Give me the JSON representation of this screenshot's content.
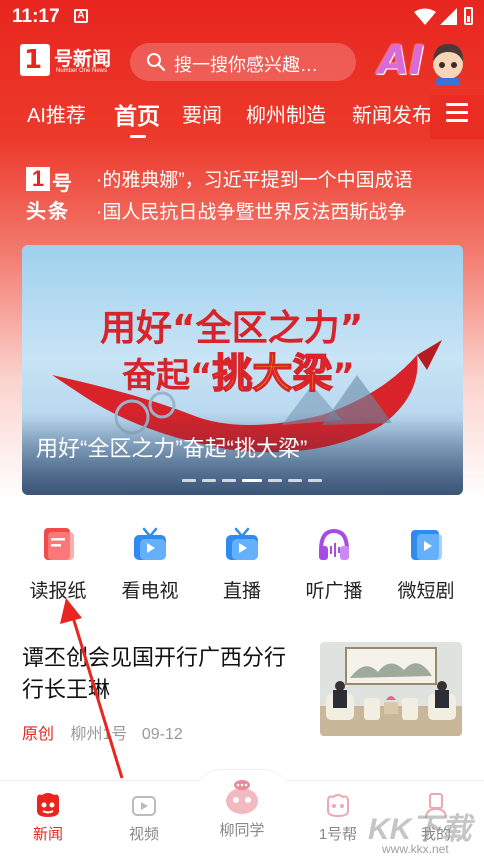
{
  "status_bar": {
    "time": "11:17",
    "notification_letter": "A"
  },
  "header": {
    "logo_num": "1",
    "logo_name": "号新闻",
    "logo_subtitle": "Number One News",
    "search_placeholder": "搜一搜你感兴趣…",
    "ai_label": "AI"
  },
  "tabs": [
    {
      "label": "AI推荐",
      "active": false
    },
    {
      "label": "首页",
      "active": true
    },
    {
      "label": "要闻",
      "active": false
    },
    {
      "label": "柳州制造",
      "active": false
    },
    {
      "label": "新闻发布",
      "active": false
    }
  ],
  "headline": {
    "logo_num": "1",
    "logo_hao": "号",
    "logo_toutiao": "头条",
    "items": [
      "·的雅典娜”，习近平提到一个中国成语",
      "·国人民抗日战争暨世界反法西斯战争"
    ]
  },
  "banner": {
    "title_part1": "用好“全区之力”",
    "title_part2_prefix": "奋起“",
    "title_part2_highlight": "挑大梁",
    "title_part2_suffix": "”",
    "caption": "用好“全区之力”奋起“挑大梁”",
    "slide_count": 7,
    "active_slide": 4
  },
  "quick_nav": [
    {
      "label": "读报纸",
      "icon": "newspaper-icon",
      "color": "#f04a4a"
    },
    {
      "label": "看电视",
      "icon": "tv-icon",
      "color": "#2f8bf0"
    },
    {
      "label": "直播",
      "icon": "live-tv-icon",
      "color": "#2f8bf0"
    },
    {
      "label": "听广播",
      "icon": "headphones-icon",
      "color": "#a74be6"
    },
    {
      "label": "微短剧",
      "icon": "short-drama-icon",
      "color": "#2f8bf0"
    }
  ],
  "news": [
    {
      "title": "谭丕创会见国开行广西分行行长王琳",
      "tag": "原创",
      "source": "柳州1号",
      "date": "09-12"
    }
  ],
  "bottom_nav": [
    {
      "label": "新闻",
      "icon": "news-icon",
      "active": true
    },
    {
      "label": "视频",
      "icon": "video-icon",
      "active": false
    },
    {
      "label": "柳同学",
      "icon": "assistant-icon",
      "active": false
    },
    {
      "label": "1号帮",
      "icon": "help-icon",
      "active": false
    },
    {
      "label": "我的",
      "icon": "profile-icon",
      "active": false
    }
  ],
  "watermark": {
    "text": "KK下载",
    "url": "www.kkx.net"
  },
  "colors": {
    "brand_red": "#e8261f",
    "text_dark": "#111111",
    "meta_gray": "#999999"
  }
}
